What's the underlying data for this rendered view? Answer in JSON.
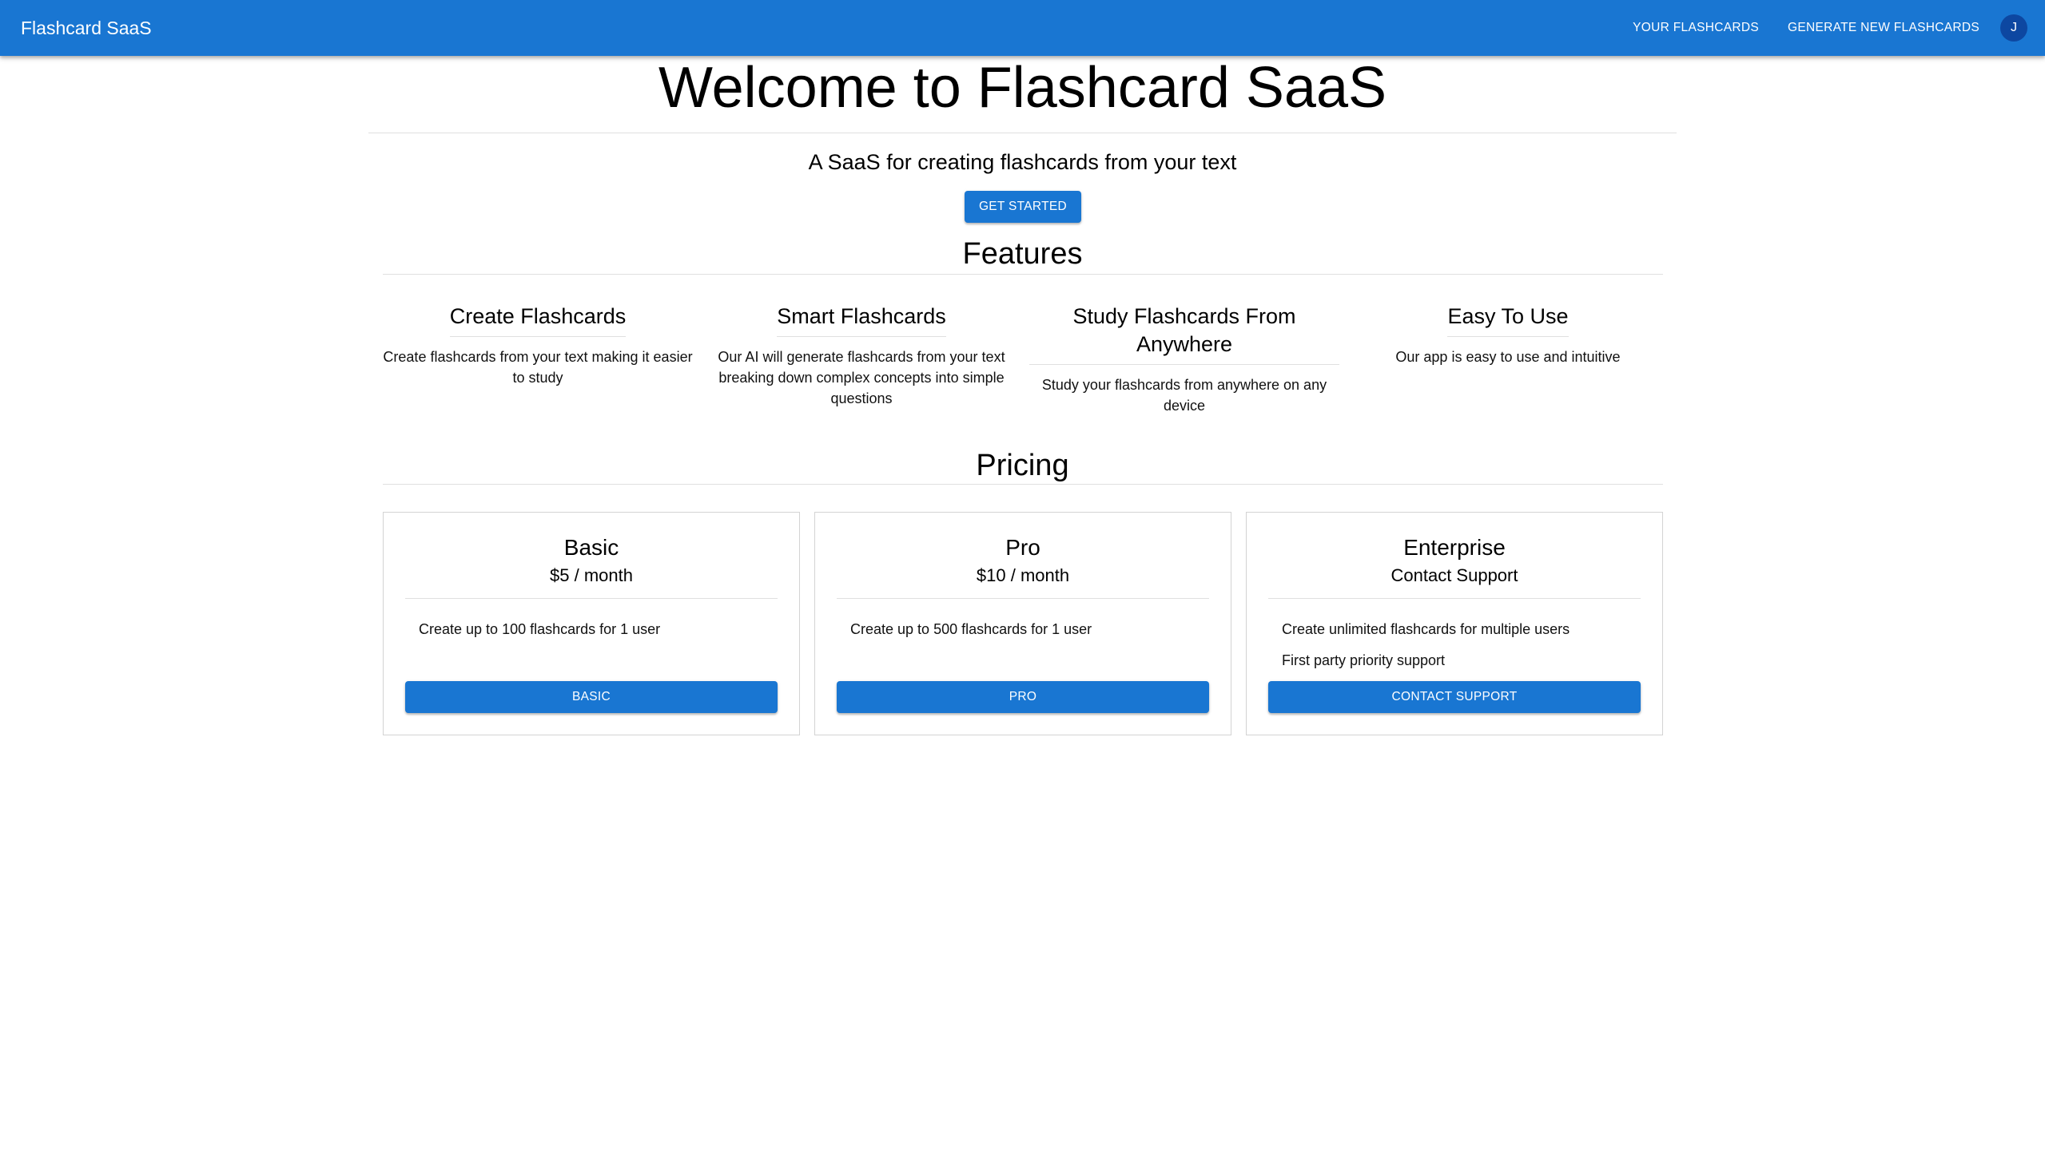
{
  "appbar": {
    "brand": "Flashcard SaaS",
    "nav": [
      "YOUR FLASHCARDS",
      "GENERATE NEW FLASHCARDS"
    ],
    "avatar_initial": "J"
  },
  "hero": {
    "title": "Welcome to Flashcard SaaS",
    "subtitle": "A SaaS for creating flashcards from your text",
    "cta": "GET STARTED"
  },
  "features": {
    "title": "Features",
    "items": [
      {
        "title": "Create Flashcards",
        "desc": "Create flashcards from your text making it easier to study"
      },
      {
        "title": "Smart Flashcards",
        "desc": "Our AI will generate flashcards from your text breaking down complex concepts into simple questions"
      },
      {
        "title": "Study Flashcards From Anywhere",
        "desc": "Study your flashcards from anywhere on any device"
      },
      {
        "title": "Easy To Use",
        "desc": "Our app is easy to use and intuitive"
      }
    ]
  },
  "pricing": {
    "title": "Pricing",
    "plans": [
      {
        "name": "Basic",
        "price": "$5 / month",
        "features": [
          "Create up to 100 flashcards for 1 user"
        ],
        "button": "BASIC"
      },
      {
        "name": "Pro",
        "price": "$10 / month",
        "features": [
          "Create up to 500 flashcards for 1 user"
        ],
        "button": "PRO"
      },
      {
        "name": "Enterprise",
        "price": "Contact Support",
        "features": [
          "Create unlimited flashcards for multiple users",
          "First party priority support"
        ],
        "button": "CONTACT SUPPORT"
      }
    ]
  },
  "colors": {
    "primary": "#1976d2",
    "avatar": "#0d47a1",
    "divider": "#e0e0e0"
  }
}
